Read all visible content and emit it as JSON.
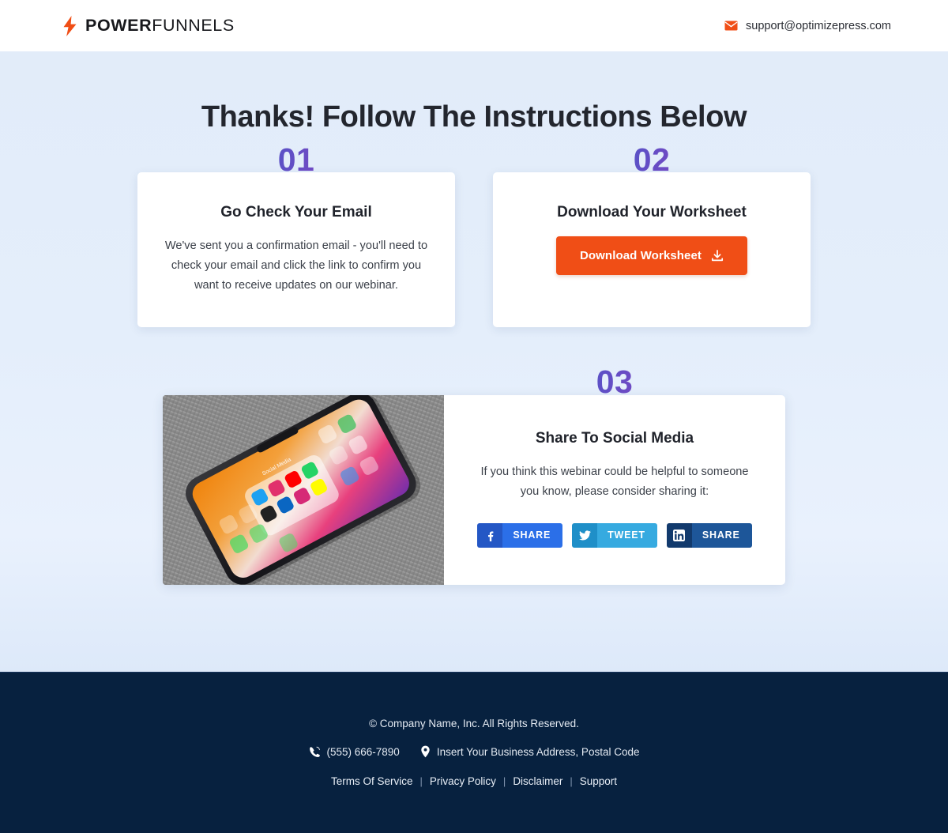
{
  "header": {
    "brand_bold": "POWER",
    "brand_light": "FUNNELS",
    "bolt_icon": "lightning-bolt-icon",
    "email": "support@optimizepress.com",
    "envelope_icon": "envelope-icon"
  },
  "main": {
    "title": "Thanks! Follow The Instructions Below",
    "steps": [
      {
        "number": "01",
        "heading": "Go Check Your Email",
        "body": "We've sent you a confirmation email - you'll need to check your email and click the link to confirm you want to receive updates on our webinar."
      },
      {
        "number": "02",
        "heading": "Download Your Worksheet",
        "button_label": "Download Worksheet",
        "button_icon": "download-icon"
      },
      {
        "number": "03",
        "heading": "Share To Social Media",
        "body": "If you think this webinar could be helpful to someone you know, please consider sharing it:",
        "image_alt": "smartphone-on-fabric-photo",
        "share_buttons": [
          {
            "network": "facebook",
            "icon": "facebook-icon",
            "label": "SHARE"
          },
          {
            "network": "twitter",
            "icon": "twitter-icon",
            "label": "TWEET"
          },
          {
            "network": "linkedin",
            "icon": "linkedin-icon",
            "label": "SHARE"
          }
        ]
      }
    ]
  },
  "footer": {
    "copyright": "© Company Name, Inc. All Rights Reserved.",
    "phone_icon": "phone-icon",
    "phone": "(555) 666-7890",
    "location_icon": "location-pin-icon",
    "address": "Insert Your Business Address, Postal Code",
    "links": [
      {
        "label": "Terms Of Service"
      },
      {
        "label": "Privacy Policy"
      },
      {
        "label": "Disclaimer"
      },
      {
        "label": "Support"
      }
    ],
    "separator": "|"
  },
  "colors": {
    "accent_orange": "#f04e16",
    "footer_navy": "#07213f",
    "page_bg": "#e4eefb",
    "gradient_start": "#2f5bd4",
    "gradient_end": "#c2399f",
    "facebook_blue": "#2b6fe8",
    "twitter_blue": "#36aae0",
    "linkedin_blue": "#1d5699"
  }
}
